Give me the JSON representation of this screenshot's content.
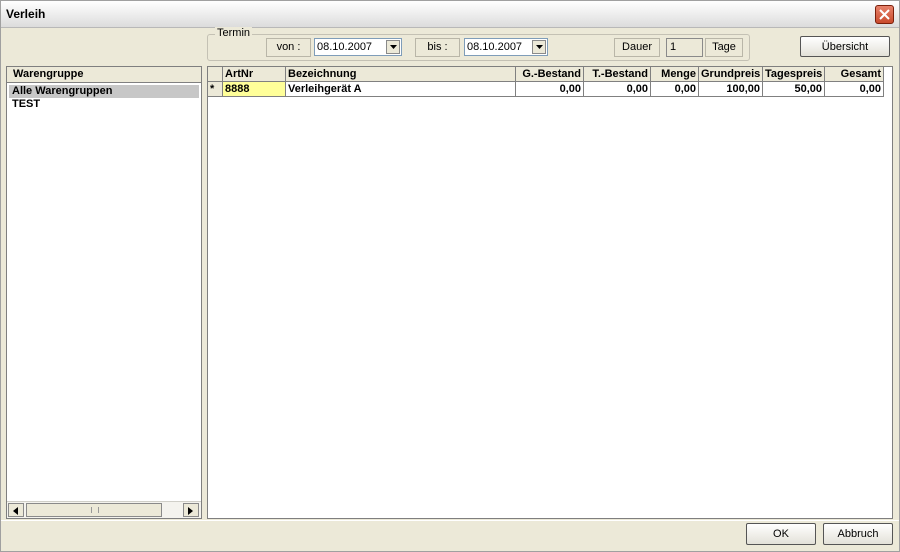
{
  "window": {
    "title": "Verleih",
    "close_icon": "close-icon"
  },
  "termin": {
    "legend": "Termin",
    "von_label": "von :",
    "von_value": "08.10.2007",
    "bis_label": "bis :",
    "bis_value": "08.10.2007",
    "dauer_label": "Dauer",
    "dauer_value": "1",
    "tage_label": "Tage"
  },
  "buttons": {
    "uebersicht": "Übersicht",
    "ok": "OK",
    "abbruch": "Abbruch"
  },
  "warengruppe": {
    "header": "Warengruppe",
    "items": [
      {
        "label": "Alle Warengruppen",
        "selected": true
      },
      {
        "label": "TEST",
        "selected": false
      }
    ]
  },
  "grid": {
    "columns": [
      "",
      "ArtNr",
      "Bezeichnung",
      "G.-Bestand",
      "T.-Bestand",
      "Menge",
      "Grundpreis",
      "Tagespreis",
      "Gesamt"
    ],
    "rows": [
      {
        "marker": "*",
        "artnr": "8888",
        "bezeichnung": "Verleihgerät A",
        "g_bestand": "0,00",
        "t_bestand": "0,00",
        "menge": "0,00",
        "grundpreis": "100,00",
        "tagespreis": "50,00",
        "gesamt": "0,00"
      }
    ]
  },
  "colors": {
    "artnr_highlight": "#ffff99",
    "selection": "#c7c7c7"
  }
}
